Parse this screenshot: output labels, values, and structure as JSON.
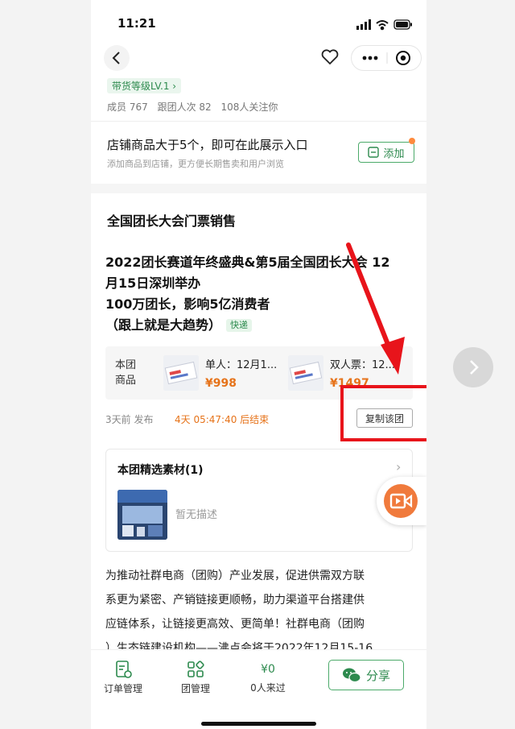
{
  "status_bar": {
    "time": "11:21"
  },
  "header": {
    "level_tag": "带货等级LV.1 ›",
    "members": "成员 767",
    "followers_count": "跟团人次 82",
    "attention": "108人关注你"
  },
  "promo": {
    "title": "店铺商品大于5个，即可在此展示入口",
    "subtitle": "添加商品到店铺，更方便长期售卖和用户浏览",
    "add_label": "添加"
  },
  "section": {
    "title": "全国团长大会门票销售"
  },
  "post": {
    "line1": "2022团长赛道年终盛典&第5届全国团长大会 12",
    "line2": "月15日深圳举办",
    "line3": "100万团长，影响5亿消费者",
    "line4": "（跟上就是大趋势）",
    "express_tag": "快递"
  },
  "products": {
    "label_line1": "本团",
    "label_line2": "商品",
    "items": [
      {
        "name": "单人：12月1...",
        "price": "¥998"
      },
      {
        "name": "双人票：12...",
        "price": "¥1497"
      }
    ]
  },
  "timing": {
    "posted": "3天前 发布",
    "ends": "4天 05:47:40 后结束",
    "copy_label": "复制该团"
  },
  "material": {
    "title": "本团精选素材(1)",
    "desc": "暂无描述"
  },
  "article": {
    "lines": [
      "为推动社群电商（团购）产业发展，促进供需双方联",
      "系更为紧密、产销链接更顺畅，助力渠道平台搭建供",
      "应链体系，让链接更高效、更简单！社群电商（团购",
      "）生态链建设机构——沸点会将于2022年12月15-16"
    ]
  },
  "tabbar": {
    "orders": "订单管理",
    "group": "团管理",
    "amount": "¥0",
    "visitors": "0人来过",
    "share": "分享"
  },
  "colors": {
    "accent_green": "#2d8a4e",
    "orange": "#e6731a",
    "highlight_red": "#e8141b"
  }
}
